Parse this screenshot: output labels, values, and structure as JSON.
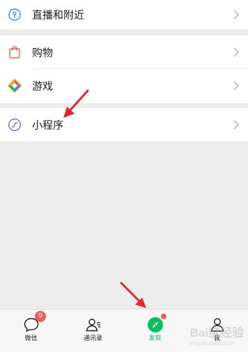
{
  "menu": {
    "live_nearby": {
      "label": "直播和附近",
      "icon": "live-nearby-icon"
    },
    "shopping": {
      "label": "购物",
      "icon": "shopping-bag-icon"
    },
    "games": {
      "label": "游戏",
      "icon": "game-diamond-icon"
    },
    "mini_programs": {
      "label": "小程序",
      "icon": "mini-program-icon"
    }
  },
  "tabbar": {
    "tabs": [
      {
        "label": "微信",
        "icon": "chat-bubble-icon",
        "badge": "9"
      },
      {
        "label": "通讯录",
        "icon": "contacts-icon"
      },
      {
        "label": "发现",
        "icon": "discover-compass-icon",
        "active": true
      },
      {
        "label": "我",
        "icon": "me-person-icon"
      }
    ]
  },
  "watermark": {
    "main": "Bai度经验",
    "sub": "jingyan.baidu.com"
  },
  "colors": {
    "accent_green": "#07c160",
    "badge_red": "#f25a55",
    "annotation_red": "#e8242a",
    "background": "#ededed"
  }
}
